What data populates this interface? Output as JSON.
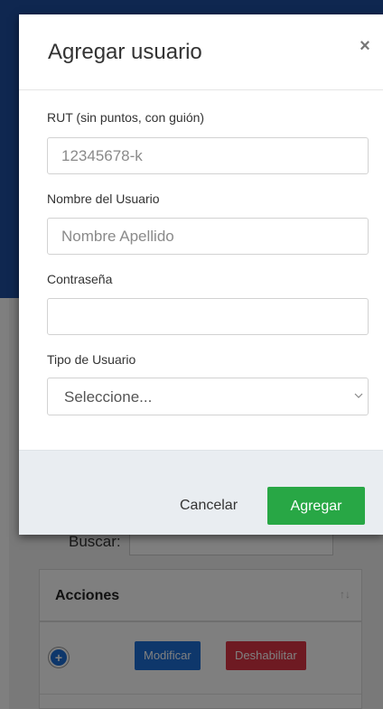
{
  "modal": {
    "title": "Agregar usuario",
    "close_glyph": "×",
    "fields": {
      "rut": {
        "label": "RUT (sin puntos, con guión)",
        "placeholder": "12345678-k",
        "value": ""
      },
      "name": {
        "label": "Nombre del Usuario",
        "placeholder": "Nombre Apellido",
        "value": ""
      },
      "password": {
        "label": "Contraseña",
        "placeholder": "",
        "value": ""
      },
      "user_type": {
        "label": "Tipo de Usuario",
        "selected": "Seleccione..."
      }
    },
    "footer": {
      "cancel_label": "Cancelar",
      "submit_label": "Agregar"
    }
  },
  "background": {
    "search_label": "Buscar:",
    "table": {
      "header": "Acciones",
      "sort_glyph": "↑↓",
      "row": {
        "expand_glyph": "+",
        "modify_label": "Modificar",
        "disable_label": "Deshabilitar"
      }
    }
  },
  "colors": {
    "header_blue": "#1f4fa0",
    "primary": "#1d6fd6",
    "success": "#28a745",
    "danger": "#dc3545"
  }
}
